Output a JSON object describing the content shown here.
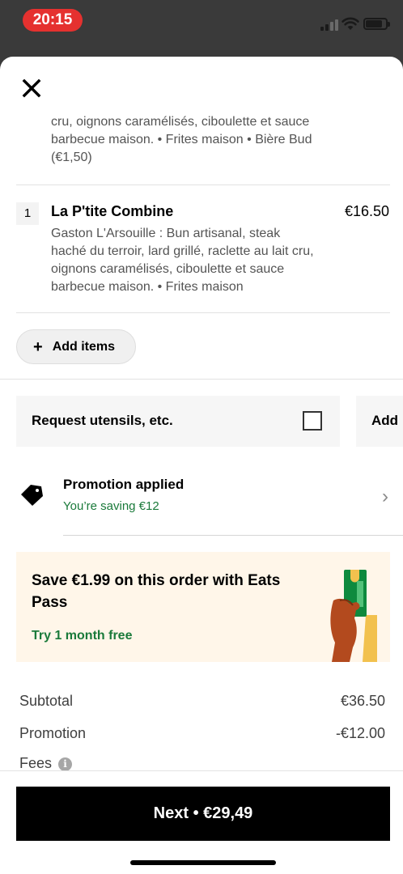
{
  "status_bar": {
    "time": "20:15",
    "time_pill_color": "#e5312f",
    "icons": [
      "cellular-signal-icon",
      "wifi-icon",
      "battery-icon"
    ]
  },
  "header": {
    "close_icon": "close-icon"
  },
  "previous_item": {
    "description_visible": "cru, oignons caramélisés, ciboulette et sauce barbecue maison. • Frites maison • Bière Bud (€1,50)"
  },
  "cart_item": {
    "quantity": "1",
    "title": "La P'tite Combine",
    "price": "€16.50",
    "description": "Gaston L'Arsouille : Bun artisanal, steak haché du terroir, lard grillé, raclette au lait cru, oignons caramélisés, ciboulette et sauce barbecue maison. • Frites maison"
  },
  "add_items": {
    "label": "Add items",
    "icon": "plus-icon"
  },
  "options": {
    "utensils_label": "Request utensils, etc.",
    "utensils_checked": false,
    "add_label": "Add"
  },
  "promotion": {
    "title": "Promotion applied",
    "subtitle": "You’re saving €12",
    "icon": "tag-icon",
    "chevron": "›"
  },
  "eats_pass": {
    "title": "Save €1.99 on this order with Eats Pass",
    "cta": "Try 1 month free",
    "illustration": "hand-holding-pass-icon",
    "background": "#fff6e9",
    "accent": "#1a7a3a"
  },
  "summary": {
    "subtotal_label": "Subtotal",
    "subtotal_value": "€36.50",
    "promotion_label": "Promotion",
    "promotion_value": "-€12.00",
    "fees_label": "Fees",
    "fees_info_icon": "i"
  },
  "footer": {
    "next_label": "Next • €29,49"
  }
}
